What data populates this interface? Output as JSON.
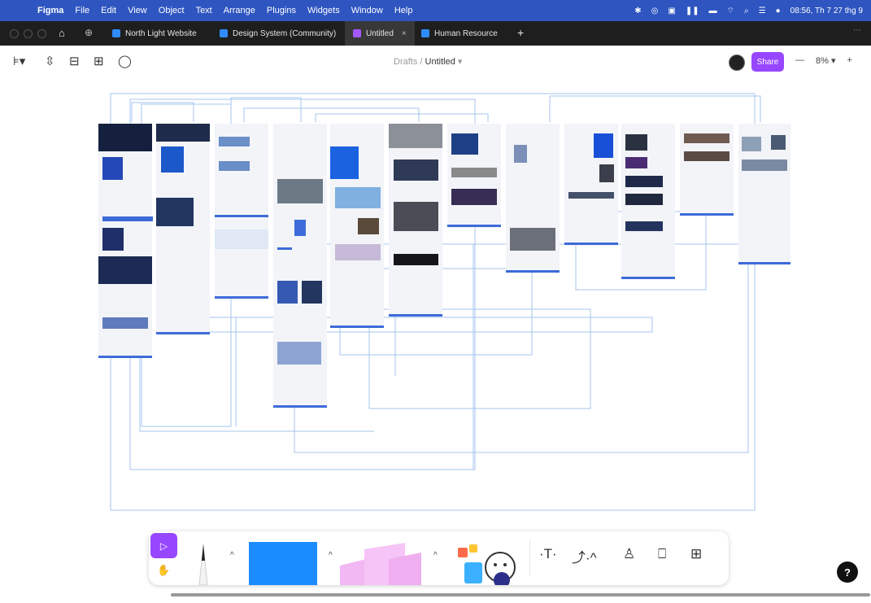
{
  "menubar": {
    "app": "Figma",
    "items": [
      "File",
      "Edit",
      "View",
      "Object",
      "Text",
      "Arrange",
      "Plugins",
      "Widgets",
      "Window",
      "Help"
    ],
    "clock": "08:56, Th 7 27 thg 9"
  },
  "tabs": [
    {
      "label": "North Light Website",
      "active": false
    },
    {
      "label": "Design System (Community)",
      "active": false
    },
    {
      "label": "Untitled",
      "active": true
    },
    {
      "label": "Human Resource",
      "active": false
    }
  ],
  "toolbar": {
    "breadcrumb_parent": "Drafts",
    "breadcrumb_sep": "/",
    "file_name": "Untitled",
    "share_label": "Share",
    "zoom": "8%"
  },
  "colors": {
    "menubar": "#2e55c0",
    "accent": "#9747ff",
    "connector": "#8fb3e8",
    "frame_blue": "#3d6bd9"
  },
  "help_label": "?"
}
